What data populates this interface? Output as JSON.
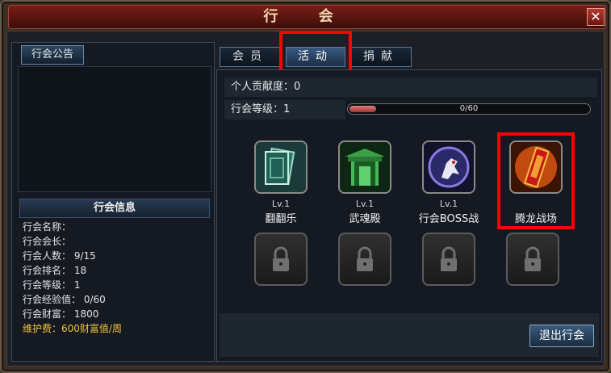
{
  "window": {
    "title": "行 会",
    "close_label": "✕"
  },
  "left_panel": {
    "notice_tab": "行会公告",
    "info_header": "行会信息",
    "info_rows": [
      "行会名称：",
      "行会会长：",
      "行会人数： 9/15",
      "行会排名： 18",
      "行会等级： 1",
      "行会经验值： 0/60",
      "行会财富：  1800"
    ],
    "maintenance": "维护费：600财富值/周"
  },
  "tabs": [
    {
      "label": "会员",
      "active": false
    },
    {
      "label": "活动",
      "active": true
    },
    {
      "label": "捐献",
      "active": false
    }
  ],
  "stats": {
    "contribution": "个人贡献度：0",
    "guild_level": "行会等级：1",
    "exp_progress_text": "0/60",
    "exp_progress_fraction": 0.11
  },
  "activities": [
    {
      "level": "Lv.1",
      "name": "翻翻乐",
      "icon": "card-deck-icon"
    },
    {
      "level": "Lv.1",
      "name": "武魂殿",
      "icon": "temple-gate-icon"
    },
    {
      "level": "Lv.1",
      "name": "行会BOSS战",
      "icon": "boss-creature-icon"
    },
    {
      "level": "",
      "name": "腾龙战场",
      "icon": "dragon-battle-banner-icon"
    }
  ],
  "locked_slots": 4,
  "quit_button": "退出行会",
  "colors": {
    "highlight": "#ff0000",
    "maintenance_text": "#f0c040",
    "title_bar": "#7a1e16"
  }
}
